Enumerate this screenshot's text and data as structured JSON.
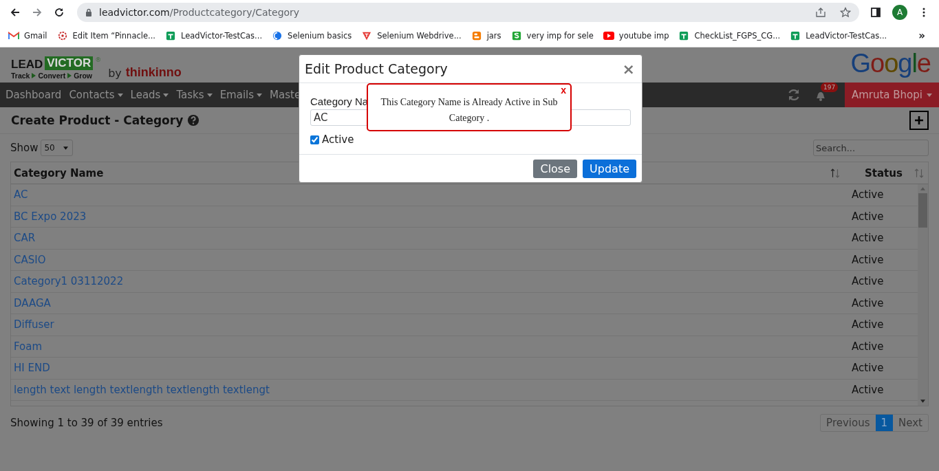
{
  "browser": {
    "url_host": "leadvictor.com",
    "url_path": "/Productcategory/Category",
    "avatar": "A",
    "bookmarks": [
      {
        "kind": "gmail",
        "label": "Gmail"
      },
      {
        "kind": "target",
        "label": "Edit Item “Pinnacle..."
      },
      {
        "kind": "sheet",
        "label": "LeadVictor-TestCas..."
      },
      {
        "kind": "globe",
        "label": "Selenium basics"
      },
      {
        "kind": "triangle",
        "label": "Selenium Webdrive..."
      },
      {
        "kind": "blogger",
        "label": "jars"
      },
      {
        "kind": "s",
        "label": "very imp for sele"
      },
      {
        "kind": "youtube",
        "label": "youtube imp"
      },
      {
        "kind": "sheet",
        "label": "CheckList_FGPS_CG..."
      },
      {
        "kind": "sheet",
        "label": "LeadVictor-TestCas..."
      }
    ],
    "more": "»"
  },
  "header": {
    "logo_lead": "LEAD",
    "logo_victor": "VICTOR",
    "logo_mark": "®",
    "tagline": [
      "Track",
      "Convert",
      "Grow"
    ],
    "by": "by",
    "brand": "thinkinno",
    "right_logo": "Google"
  },
  "nav": {
    "items": [
      {
        "label": "Dashboard",
        "dropdown": false
      },
      {
        "label": "Contacts",
        "dropdown": true
      },
      {
        "label": "Leads",
        "dropdown": true
      },
      {
        "label": "Tasks",
        "dropdown": true
      },
      {
        "label": "Emails",
        "dropdown": true
      },
      {
        "label": "Maste",
        "dropdown": false
      }
    ],
    "notifications": "197",
    "user": "Amruta Bhopi"
  },
  "page": {
    "title": "Create Product - Category",
    "show_label": "Show",
    "page_size": "50",
    "search_placeholder": "Search...",
    "columns": [
      "Category Name",
      "Status"
    ],
    "rows": [
      {
        "name": "AC",
        "status": "Active"
      },
      {
        "name": "BC Expo 2023",
        "status": "Active"
      },
      {
        "name": "CAR",
        "status": "Active"
      },
      {
        "name": "CASIO",
        "status": "Active"
      },
      {
        "name": "Category1 03112022",
        "status": "Active"
      },
      {
        "name": "DAAGA",
        "status": "Active"
      },
      {
        "name": "Diffuser",
        "status": "Active"
      },
      {
        "name": "Foam",
        "status": "Active"
      },
      {
        "name": "HI END",
        "status": "Active"
      },
      {
        "name": "length text length textlength textlength textlengt",
        "status": "Active"
      }
    ],
    "info": "Showing 1 to 39 of 39 entries",
    "pagination": [
      {
        "label": "Previous",
        "selected": false
      },
      {
        "label": "1",
        "selected": true
      },
      {
        "label": "Next",
        "selected": false
      }
    ]
  },
  "modal": {
    "title": "Edit Product Category",
    "close": "×",
    "field_label": "Category Na",
    "field_value": "AC",
    "active_label": "Active",
    "active_checked": true,
    "buttons": [
      {
        "kind": "secondary",
        "label": "Close"
      },
      {
        "kind": "primary",
        "label": "Update"
      }
    ]
  },
  "toast": {
    "message": "This Category Name is Already Active in Sub Category .",
    "close": "x"
  }
}
